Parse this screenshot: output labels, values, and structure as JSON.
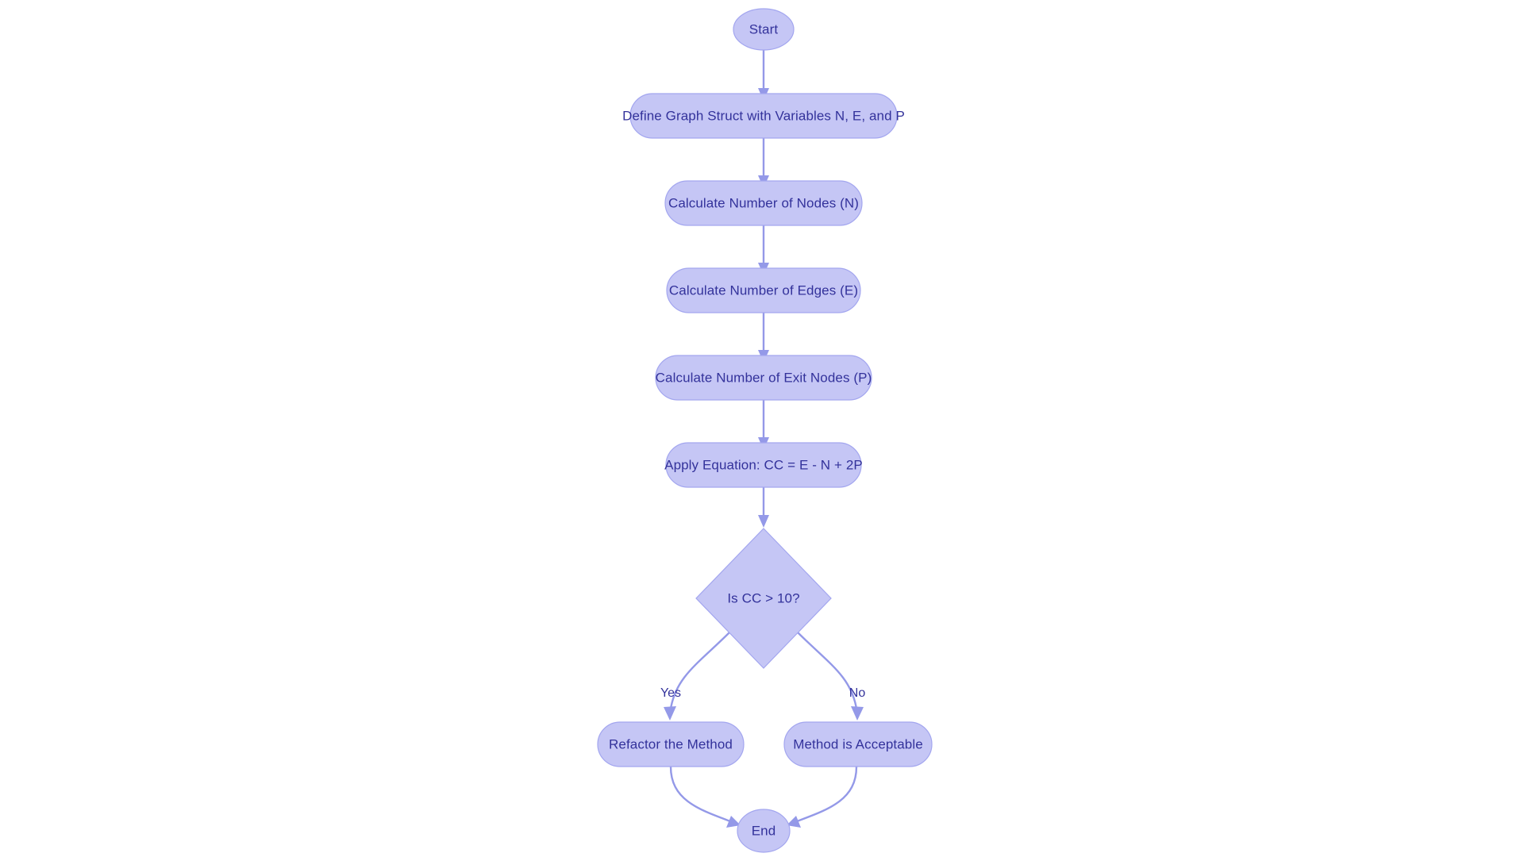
{
  "diagram": {
    "type": "flowchart",
    "orientation": "top-to-bottom",
    "background_color": "#ffffff",
    "node_fill_color": "#c5c6f5",
    "node_border_color": "#a3a6ef",
    "node_text_color": "#33329b",
    "edge_color": "#9499e8",
    "nodes": [
      {
        "id": "start",
        "label": "Start",
        "shape": "ellipse"
      },
      {
        "id": "define",
        "label": "Define Graph Struct with Variables N, E, and P",
        "shape": "stadium"
      },
      {
        "id": "nodes_n",
        "label": "Calculate Number of Nodes (N)",
        "shape": "stadium"
      },
      {
        "id": "edges_e",
        "label": "Calculate Number of Edges (E)",
        "shape": "stadium"
      },
      {
        "id": "exits_p",
        "label": "Calculate Number of Exit Nodes (P)",
        "shape": "stadium"
      },
      {
        "id": "equation",
        "label": "Apply Equation: CC = E - N + 2P",
        "shape": "stadium"
      },
      {
        "id": "decision",
        "label": "Is CC > 10?",
        "shape": "diamond"
      },
      {
        "id": "refactor",
        "label": "Refactor the Method",
        "shape": "stadium"
      },
      {
        "id": "accept",
        "label": "Method is Acceptable",
        "shape": "stadium"
      },
      {
        "id": "end",
        "label": "End",
        "shape": "ellipse"
      }
    ],
    "edges": [
      {
        "from": "start",
        "to": "define",
        "label": ""
      },
      {
        "from": "define",
        "to": "nodes_n",
        "label": ""
      },
      {
        "from": "nodes_n",
        "to": "edges_e",
        "label": ""
      },
      {
        "from": "edges_e",
        "to": "exits_p",
        "label": ""
      },
      {
        "from": "exits_p",
        "to": "equation",
        "label": ""
      },
      {
        "from": "equation",
        "to": "decision",
        "label": ""
      },
      {
        "from": "decision",
        "to": "refactor",
        "label": "Yes"
      },
      {
        "from": "decision",
        "to": "accept",
        "label": "No"
      },
      {
        "from": "refactor",
        "to": "end",
        "label": ""
      },
      {
        "from": "accept",
        "to": "end",
        "label": ""
      }
    ]
  }
}
